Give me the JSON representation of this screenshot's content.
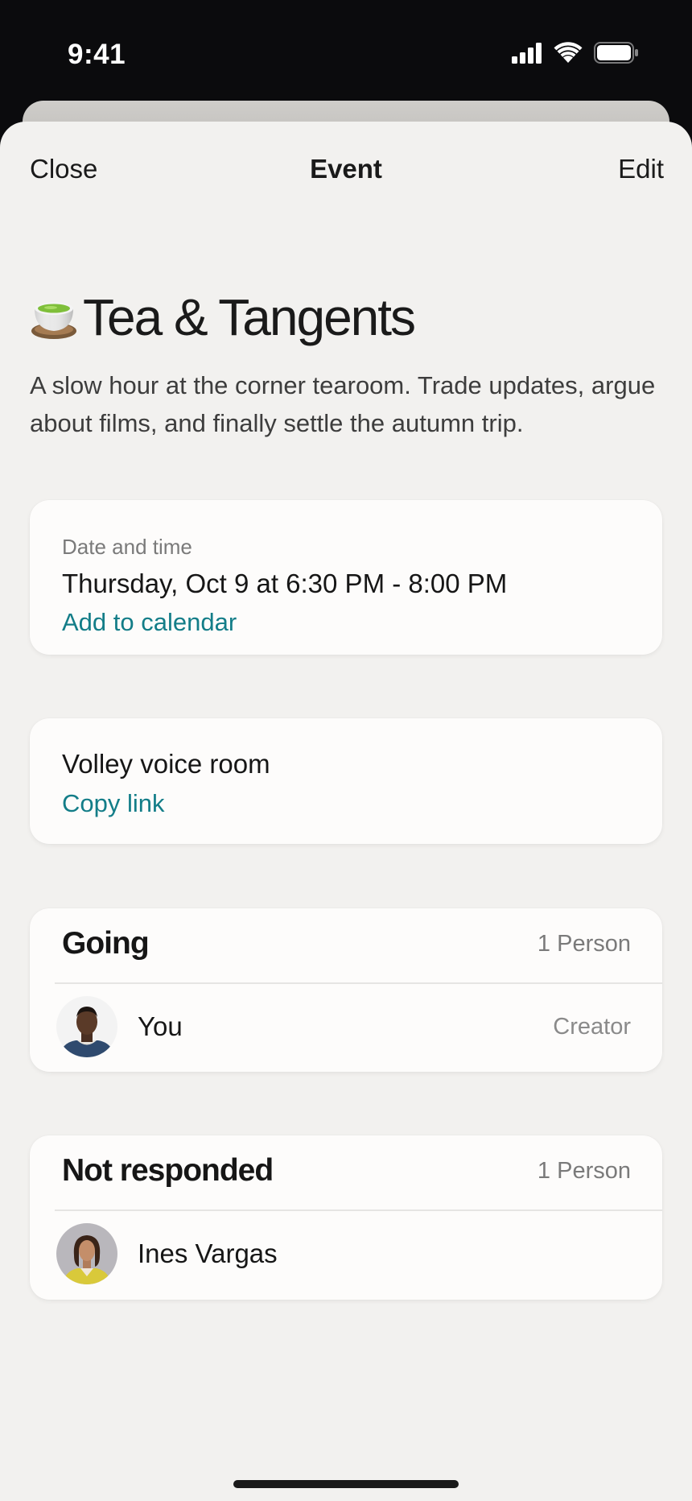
{
  "status_bar": {
    "time": "9:41"
  },
  "nav": {
    "close_label": "Close",
    "title": "Event",
    "edit_label": "Edit"
  },
  "event": {
    "emoji_icon": "tea-cup-icon",
    "title": "Tea & Tangents",
    "description": "A slow hour at the corner tearoom. Trade updates, argue about films, and finally settle the autumn trip."
  },
  "datetime_card": {
    "label": "Date and time",
    "value": "Thursday, Oct 9 at 6:30 PM - 8:00 PM",
    "action_label": "Add to calendar"
  },
  "voice_card": {
    "name": "Volley voice room",
    "action_label": "Copy link"
  },
  "going": {
    "heading": "Going",
    "count": "1 Person",
    "people": [
      {
        "name": "You",
        "role": "Creator"
      }
    ]
  },
  "not_responded": {
    "heading": "Not responded",
    "count": "1 Person",
    "people": [
      {
        "name": "Ines Vargas"
      }
    ]
  },
  "colors": {
    "accent": "#137d88",
    "sheet": "#f2f1ef",
    "card": "#fdfcfb"
  }
}
